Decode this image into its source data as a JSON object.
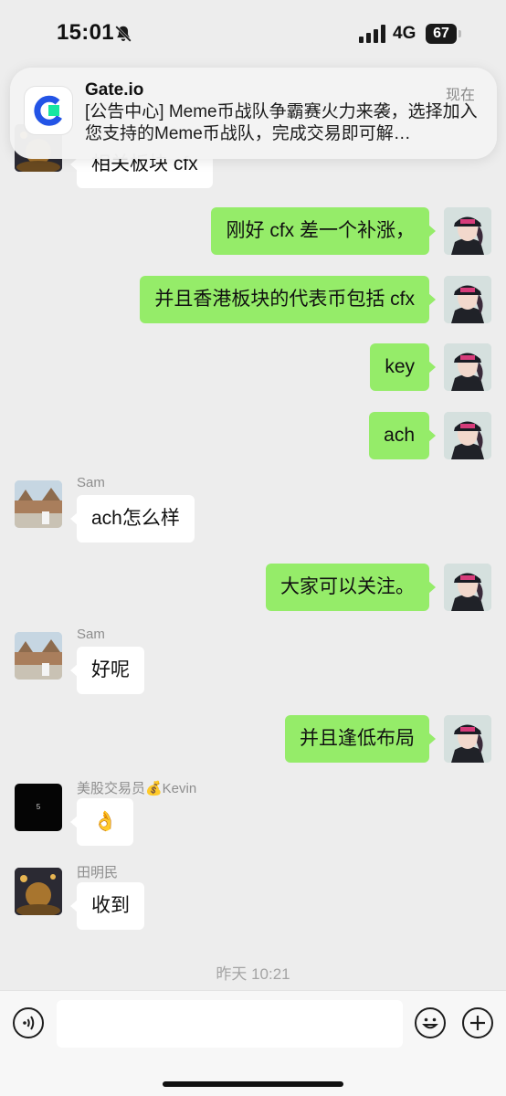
{
  "status_bar": {
    "time": "15:01",
    "network": "4G",
    "battery": "67"
  },
  "notification": {
    "app_name": "Gate.io",
    "time": "现在",
    "body": "[公告中心] Meme币战队争霸赛火力来袭，选择加入您支持的Meme币战队，完成交易即可解…"
  },
  "messages": [
    {
      "side": "left",
      "text": "相关板块 cfx"
    },
    {
      "side": "right",
      "text": "刚好 cfx 差一个补涨，"
    },
    {
      "side": "right",
      "text": "并且香港板块的代表币包括 cfx"
    },
    {
      "side": "right",
      "text": "key"
    },
    {
      "side": "right",
      "text": "ach"
    },
    {
      "side": "left",
      "sender": "Sam",
      "text": "ach怎么样"
    },
    {
      "side": "right",
      "text": "大家可以关注。"
    },
    {
      "side": "left",
      "sender": "Sam",
      "text": "好呢"
    },
    {
      "side": "right",
      "text": "并且逢低布局"
    },
    {
      "side": "left",
      "sender": "美股交易员💰Kevin",
      "text": "👌",
      "avatar_text": "5"
    },
    {
      "side": "left",
      "sender": "田明民",
      "text": "收到"
    }
  ],
  "timestamp": "昨天 10:21",
  "input": {
    "placeholder": ""
  },
  "icons": {
    "voice": "voice-icon",
    "emoji": "emoji-icon",
    "plus": "plus-icon",
    "app_logo": "gate-io-logo-icon"
  },
  "colors": {
    "my_bubble": "#95ec69",
    "their_bubble": "#ffffff",
    "background": "#ededed"
  }
}
